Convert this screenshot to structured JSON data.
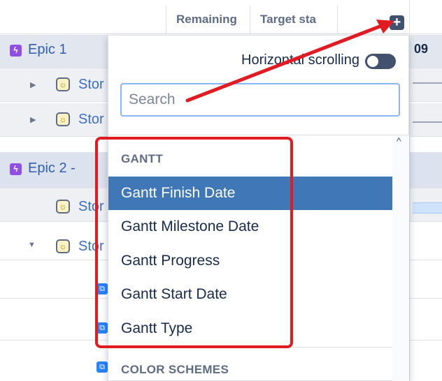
{
  "columns": {
    "remaining": "Remaining",
    "target_start": "Target sta",
    "extra": ""
  },
  "right_value": "09",
  "rows": {
    "epic1": "Epic 1",
    "story1": "Stor",
    "story2": "Stor",
    "epic2": "Epic 2  -",
    "story3": "Stor",
    "story4": "Stor"
  },
  "icons": {
    "add_column": "plus-square-icon",
    "epic": "lightning-icon",
    "story": "lightbulb-icon",
    "subtask": "subtask-icon",
    "scroll_up": "chevron-up-icon"
  },
  "add_column_glyph": "+",
  "epic_glyph": "ϟ",
  "story_glyph": "☼",
  "sub_glyph": "⧉",
  "panel": {
    "horizontal_scrolling_label": "Horizontal scrolling",
    "search_placeholder": "Search",
    "scroll_up_glyph": "^",
    "groups": [
      {
        "name": "GANTT",
        "options": [
          "Gantt Finish Date",
          "Gantt Milestone Date",
          "Gantt Progress",
          "Gantt Start Date",
          "Gantt Type"
        ]
      },
      {
        "name": "COLOR SCHEMES",
        "options": []
      }
    ]
  },
  "colors": {
    "selected_bg": "#3f77b7",
    "annotation": "#e11b22",
    "epic": "#904ee2"
  }
}
